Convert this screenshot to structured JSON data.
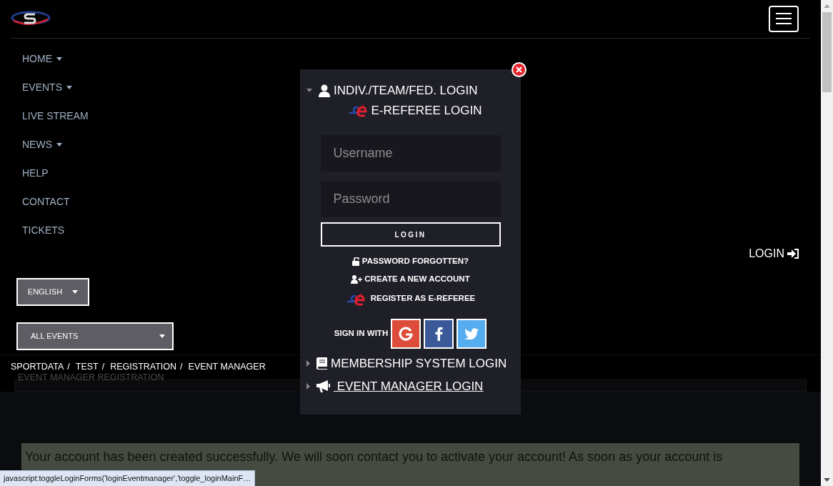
{
  "nav": [
    {
      "label": "HOME",
      "dropdown": true
    },
    {
      "label": "EVENTS",
      "dropdown": true
    },
    {
      "label": "LIVE STREAM",
      "dropdown": false
    },
    {
      "label": "NEWS",
      "dropdown": true
    },
    {
      "label": "HELP",
      "dropdown": false
    },
    {
      "label": "CONTACT",
      "dropdown": false
    },
    {
      "label": "TICKETS",
      "dropdown": false
    }
  ],
  "login_link": "LOGIN",
  "language_select": "ENGLISH",
  "events_select": "ALL EVENTS",
  "breadcrumb": [
    "SPORTDATA",
    "TEST",
    "REGISTRATION",
    "EVENT MANAGER"
  ],
  "breadcrumb_separator": "/",
  "panel_title": "EVENT MANAGER REGISTRATION",
  "message": "Your account has been created successfully. We will soon contact you to activate your account! As soon as your account is",
  "login_popup": {
    "sections": [
      {
        "kind": "person",
        "label": "INDIV./TEAM/FED. LOGIN",
        "expanded": true
      },
      {
        "kind": "referee",
        "label": "E-REFEREE LOGIN"
      },
      {
        "kind": "book",
        "label": "MEMBERSHIP SYSTEM LOGIN",
        "expanded": false
      },
      {
        "kind": "megaphone",
        "label": " EVENT MANAGER LOGIN",
        "expanded": false
      }
    ],
    "username_placeholder": "Username",
    "password_placeholder": "Password",
    "login_button": "LOGIN",
    "links": [
      {
        "kind": "lock",
        "label": "PASSWORD FORGOTTEN?"
      },
      {
        "kind": "add-user",
        "label": "CREATE A NEW ACCOUNT"
      },
      {
        "kind": "referee",
        "label": "REGISTER AS E-REFEREE"
      }
    ],
    "sign_in_with": "SIGN IN WITH",
    "social": [
      {
        "kind": "google",
        "color": "#dd4b39"
      },
      {
        "kind": "facebook",
        "color": "#3b5998"
      },
      {
        "kind": "twitter",
        "color": "#55acee"
      }
    ]
  },
  "status_url": "javascript:toggleLoginForms('loginEventmanager','toggle_loginMainF…"
}
